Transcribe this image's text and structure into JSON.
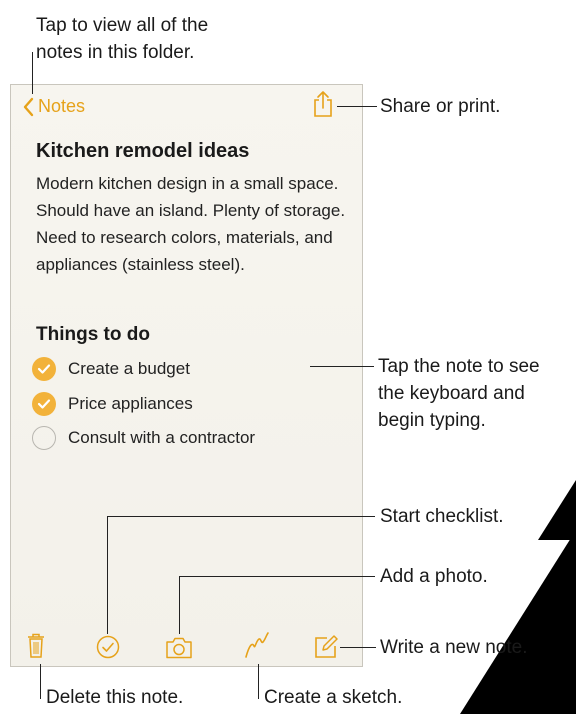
{
  "callouts": {
    "notes_list": [
      "Tap to view all of the",
      "notes in this folder."
    ],
    "share": "Share or print.",
    "tap_note": [
      "Tap the note to see",
      "the keyboard and",
      "begin typing."
    ],
    "checklist": "Start checklist.",
    "photo": "Add a photo.",
    "new_note": "Write a new note.",
    "delete": "Delete this note.",
    "sketch": "Create a sketch."
  },
  "nav": {
    "back_label": "Notes"
  },
  "note": {
    "title": "Kitchen remodel ideas",
    "body": "Modern kitchen design in a small space. Should have an island. Plenty of storage. Need to research colors, materials, and appliances (stainless steel).",
    "section_title": "Things to do",
    "checklist": [
      {
        "label": "Create a budget",
        "checked": true
      },
      {
        "label": "Price appliances",
        "checked": true
      },
      {
        "label": "Consult with a contractor",
        "checked": false
      }
    ]
  },
  "colors": {
    "accent": "#e6a21a",
    "check_fill": "#f2b23a",
    "paper": "#f5f3ed"
  },
  "icons": {
    "back": "chevron-left-icon",
    "share": "share-icon",
    "trash": "trash-icon",
    "checklist": "checklist-icon",
    "camera": "camera-icon",
    "sketch": "sketch-icon",
    "compose": "compose-icon"
  }
}
